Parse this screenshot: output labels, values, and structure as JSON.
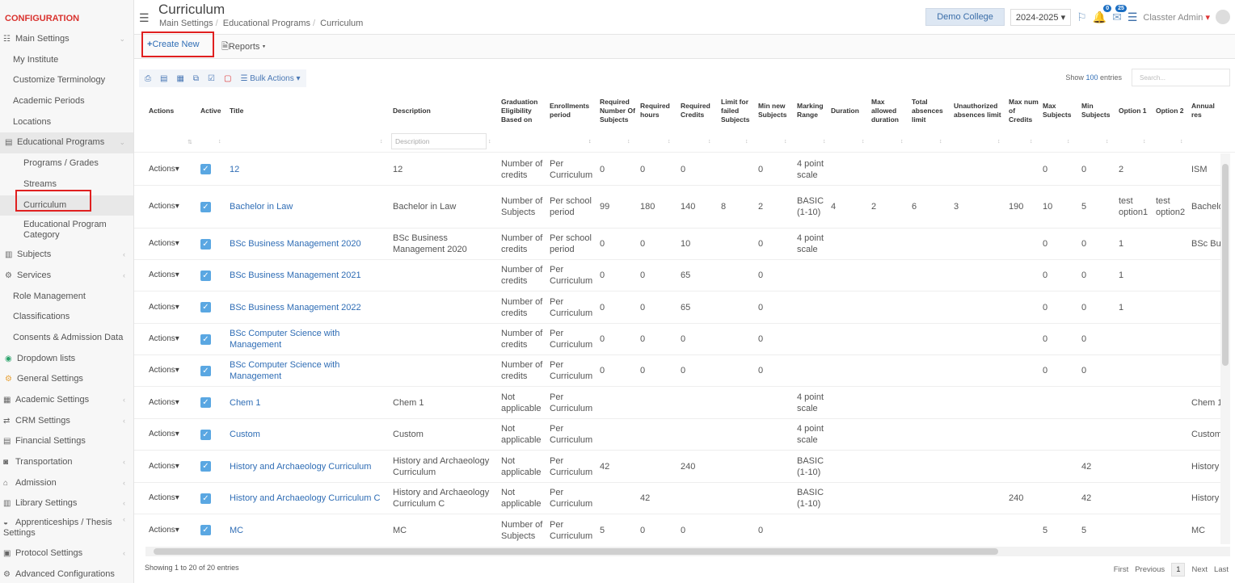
{
  "sidebar": {
    "title": "CONFIGURATION",
    "items": [
      {
        "label": "Main Settings",
        "icon": "sliders-icon"
      },
      {
        "label": "My Institute"
      },
      {
        "label": "Customize Terminology"
      },
      {
        "label": "Academic Periods"
      },
      {
        "label": "Locations"
      },
      {
        "label": "Educational Programs",
        "icon": "book-icon"
      },
      {
        "label": "Programs / Grades"
      },
      {
        "label": "Streams"
      },
      {
        "label": "Curriculum"
      },
      {
        "label": "Educational Program Category"
      },
      {
        "label": "Subjects",
        "icon": "books-icon"
      },
      {
        "label": "Services",
        "icon": "services-icon"
      },
      {
        "label": "Role Management"
      },
      {
        "label": "Classifications"
      },
      {
        "label": "Consents & Admission Data"
      },
      {
        "label": "Dropdown lists",
        "icon": "layers-icon"
      },
      {
        "label": "General Settings",
        "icon": "gears-icon"
      },
      {
        "label": "Academic Settings",
        "icon": "grid-icon"
      },
      {
        "label": "CRM Settings",
        "icon": "shuffle-icon"
      },
      {
        "label": "Financial Settings",
        "icon": "money-icon"
      },
      {
        "label": "Transportation",
        "icon": "bus-icon"
      },
      {
        "label": "Admission",
        "icon": "bank-icon"
      },
      {
        "label": "Library Settings",
        "icon": "library-icon"
      },
      {
        "label": "Apprenticeships / Thesis Settings",
        "icon": "graduation-icon"
      },
      {
        "label": "Protocol Settings",
        "icon": "inbox-icon"
      },
      {
        "label": "Advanced Configurations",
        "icon": "cogs-icon"
      }
    ]
  },
  "header": {
    "title": "Curriculum",
    "breadcrumbs": [
      "Main Settings",
      "Educational Programs",
      "Curriculum"
    ],
    "college": "Demo College",
    "year": "2024-2025",
    "notif_badge": "0",
    "msg_badge": "25",
    "user": "Classter Admin"
  },
  "toolbar": {
    "create": "Create New",
    "reports": "Reports"
  },
  "table_tools": {
    "bulk": "Bulk Actions",
    "show_prefix": "Show",
    "show_count": "100",
    "show_suffix": "entries",
    "search_placeholder": "Search...",
    "desc_filter_placeholder": "Description"
  },
  "columns": [
    "Actions",
    "Active",
    "Title",
    "Description",
    "Graduation Eligibility Based on",
    "Enrollments period",
    "Required Number Of Subjects",
    "Required hours",
    "Required Credits",
    "Limit for failed Subjects",
    "Min new Subjects",
    "Marking Range",
    "Duration",
    "Max allowed duration",
    "Total absences limit",
    "Unauthorized absences limit",
    "Max num of Credits",
    "Max Subjects",
    "Min Subjects",
    "Option 1",
    "Option 2",
    "Annual res"
  ],
  "rows": [
    {
      "action": "Actions",
      "title": "12",
      "desc": "12",
      "grad": "Number of credits",
      "enroll": "Per Curriculum",
      "rns": "0",
      "rh": "0",
      "rc": "0",
      "lfs": "",
      "mns": "0",
      "mark": "4 point scale",
      "dur": "",
      "mad": "",
      "tal": "",
      "ual": "",
      "mnc": "",
      "maxs": "0",
      "mins": "0",
      "o1": "2",
      "o2": "",
      "ann": "ISM"
    },
    {
      "action": "Actions",
      "title": "Bachelor in Law",
      "desc": "Bachelor in Law",
      "grad": "Number of Subjects",
      "enroll": "Per school period",
      "rns": "99",
      "rh": "180",
      "rc": "140",
      "lfs": "8",
      "mns": "2",
      "mark": "BASIC (1-10)",
      "dur": "4",
      "mad": "2",
      "tal": "6",
      "ual": "3",
      "mnc": "190",
      "maxs": "10",
      "mins": "5",
      "o1": "test option1",
      "o2": "test option2",
      "ann": "Bachelo"
    },
    {
      "action": "Actions",
      "title": "BSc Business Management 2020",
      "desc": "BSc Business Management 2020",
      "grad": "Number of credits",
      "enroll": "Per school period",
      "rns": "0",
      "rh": "0",
      "rc": "10",
      "lfs": "",
      "mns": "0",
      "mark": "4 point scale",
      "dur": "",
      "mad": "",
      "tal": "",
      "ual": "",
      "mnc": "",
      "maxs": "0",
      "mins": "0",
      "o1": "1",
      "o2": "",
      "ann": "BSc Bu"
    },
    {
      "action": "Actions",
      "title": "BSc Business Management 2021",
      "desc": "",
      "grad": "Number of credits",
      "enroll": "Per Curriculum",
      "rns": "0",
      "rh": "0",
      "rc": "65",
      "lfs": "",
      "mns": "0",
      "mark": "",
      "dur": "",
      "mad": "",
      "tal": "",
      "ual": "",
      "mnc": "",
      "maxs": "0",
      "mins": "0",
      "o1": "1",
      "o2": "",
      "ann": ""
    },
    {
      "action": "Actions",
      "title": "BSc Business Management 2022",
      "desc": "",
      "grad": "Number of credits",
      "enroll": "Per Curriculum",
      "rns": "0",
      "rh": "0",
      "rc": "65",
      "lfs": "",
      "mns": "0",
      "mark": "",
      "dur": "",
      "mad": "",
      "tal": "",
      "ual": "",
      "mnc": "",
      "maxs": "0",
      "mins": "0",
      "o1": "1",
      "o2": "",
      "ann": ""
    },
    {
      "action": "Actions",
      "title": "BSc Computer Science with Management",
      "desc": "",
      "grad": "Number of credits",
      "enroll": "Per Curriculum",
      "rns": "0",
      "rh": "0",
      "rc": "0",
      "lfs": "",
      "mns": "0",
      "mark": "",
      "dur": "",
      "mad": "",
      "tal": "",
      "ual": "",
      "mnc": "",
      "maxs": "0",
      "mins": "0",
      "o1": "",
      "o2": "",
      "ann": ""
    },
    {
      "action": "Actions",
      "title": "BSc Computer Science with Management",
      "desc": "",
      "grad": "Number of credits",
      "enroll": "Per Curriculum",
      "rns": "0",
      "rh": "0",
      "rc": "0",
      "lfs": "",
      "mns": "0",
      "mark": "",
      "dur": "",
      "mad": "",
      "tal": "",
      "ual": "",
      "mnc": "",
      "maxs": "0",
      "mins": "0",
      "o1": "",
      "o2": "",
      "ann": ""
    },
    {
      "action": "Actions",
      "title": "Chem 1",
      "desc": "Chem 1",
      "grad": "Not applicable",
      "enroll": "Per Curriculum",
      "rns": "",
      "rh": "",
      "rc": "",
      "lfs": "",
      "mns": "",
      "mark": "4 point scale",
      "dur": "",
      "mad": "",
      "tal": "",
      "ual": "",
      "mnc": "",
      "maxs": "",
      "mins": "",
      "o1": "",
      "o2": "",
      "ann": "Chem 1"
    },
    {
      "action": "Actions",
      "title": "Custom",
      "desc": "Custom",
      "grad": "Not applicable",
      "enroll": "Per Curriculum",
      "rns": "",
      "rh": "",
      "rc": "",
      "lfs": "",
      "mns": "",
      "mark": "4 point scale",
      "dur": "",
      "mad": "",
      "tal": "",
      "ual": "",
      "mnc": "",
      "maxs": "",
      "mins": "",
      "o1": "",
      "o2": "",
      "ann": "Custom"
    },
    {
      "action": "Actions",
      "title": "History and Archaeology Curriculum",
      "desc": "History and Archaeology Curriculum",
      "grad": "Not applicable",
      "enroll": "Per Curriculum",
      "rns": "42",
      "rh": "",
      "rc": "240",
      "lfs": "",
      "mns": "",
      "mark": "BASIC (1-10)",
      "dur": "",
      "mad": "",
      "tal": "",
      "ual": "",
      "mnc": "",
      "maxs": "",
      "mins": "42",
      "o1": "",
      "o2": "",
      "ann": "History"
    },
    {
      "action": "Actions",
      "title": "History and Archaeology Curriculum C",
      "desc": "History and Archaeology Curriculum C",
      "grad": "Not applicable",
      "enroll": "Per Curriculum",
      "rns": "",
      "rh": "42",
      "rc": "",
      "lfs": "",
      "mns": "",
      "mark": "BASIC (1-10)",
      "dur": "",
      "mad": "",
      "tal": "",
      "ual": "",
      "mnc": "240",
      "maxs": "",
      "mins": "42",
      "o1": "",
      "o2": "",
      "ann": "History"
    },
    {
      "action": "Actions",
      "title": "MC",
      "desc": "MC",
      "grad": "Number of Subjects",
      "enroll": "Per Curriculum",
      "rns": "5",
      "rh": "0",
      "rc": "0",
      "lfs": "",
      "mns": "0",
      "mark": "",
      "dur": "",
      "mad": "",
      "tal": "",
      "ual": "",
      "mnc": "",
      "maxs": "5",
      "mins": "5",
      "o1": "",
      "o2": "",
      "ann": "MC"
    }
  ],
  "footer": {
    "info": "Showing 1 to 20 of 20 entries",
    "first": "First",
    "previous": "Previous",
    "page": "1",
    "next": "Next",
    "last": "Last"
  },
  "colors": {
    "brand_red": "#d9322e",
    "link_blue": "#2f6db5",
    "checkbox_blue": "#5aa7e2",
    "highlight_red": "#e02020"
  }
}
